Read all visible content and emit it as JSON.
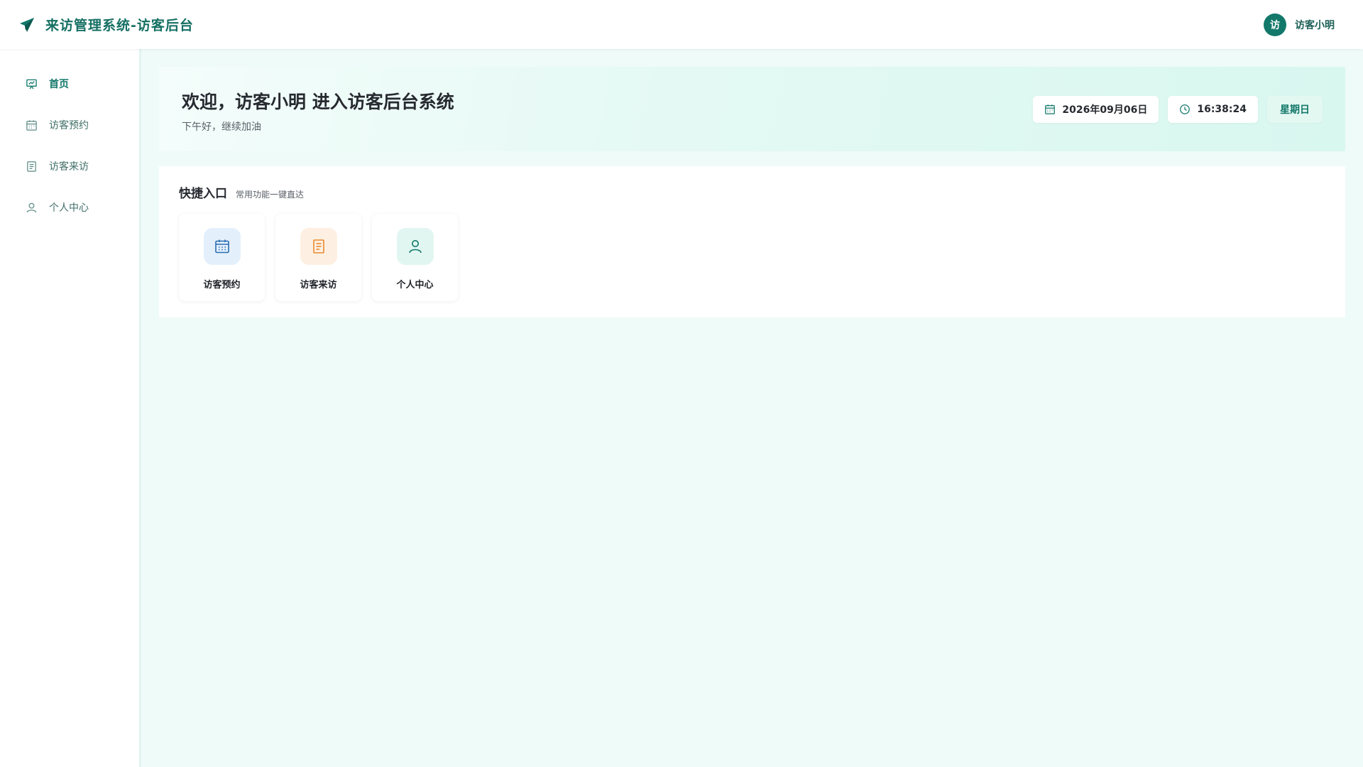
{
  "header": {
    "brand_icon": "paper-plane-icon",
    "title": "来访管理系统-访客后台",
    "avatar_text": "访",
    "user_name": "访客小明"
  },
  "sidebar": {
    "items": [
      {
        "label": "首页",
        "icon": "presentation-chart-icon",
        "active": true
      },
      {
        "label": "访客预约",
        "icon": "calendar-icon",
        "active": false
      },
      {
        "label": "访客来访",
        "icon": "document-icon",
        "active": false
      },
      {
        "label": "个人中心",
        "icon": "user-icon",
        "active": false
      }
    ]
  },
  "welcome": {
    "title": "欢迎，访客小明 进入访客后台系统",
    "subtitle": "下午好，继续加油",
    "date": "2026年09月06日",
    "time": "16:38:24",
    "weekday": "星期日"
  },
  "quick": {
    "title": "快捷入口",
    "subtitle": "常用功能一键直达",
    "cards": [
      {
        "label": "访客预约",
        "icon": "calendar-icon",
        "color": "#2b6cb0",
        "bg": "#e3f0fc"
      },
      {
        "label": "访客来访",
        "icon": "document-icon",
        "color": "#e8892e",
        "bg": "#fdf0e2"
      },
      {
        "label": "个人中心",
        "icon": "user-icon",
        "color": "#12786a",
        "bg": "#e2f6f1"
      }
    ]
  },
  "colors": {
    "primary": "#12786a",
    "background": "#effbf8"
  }
}
